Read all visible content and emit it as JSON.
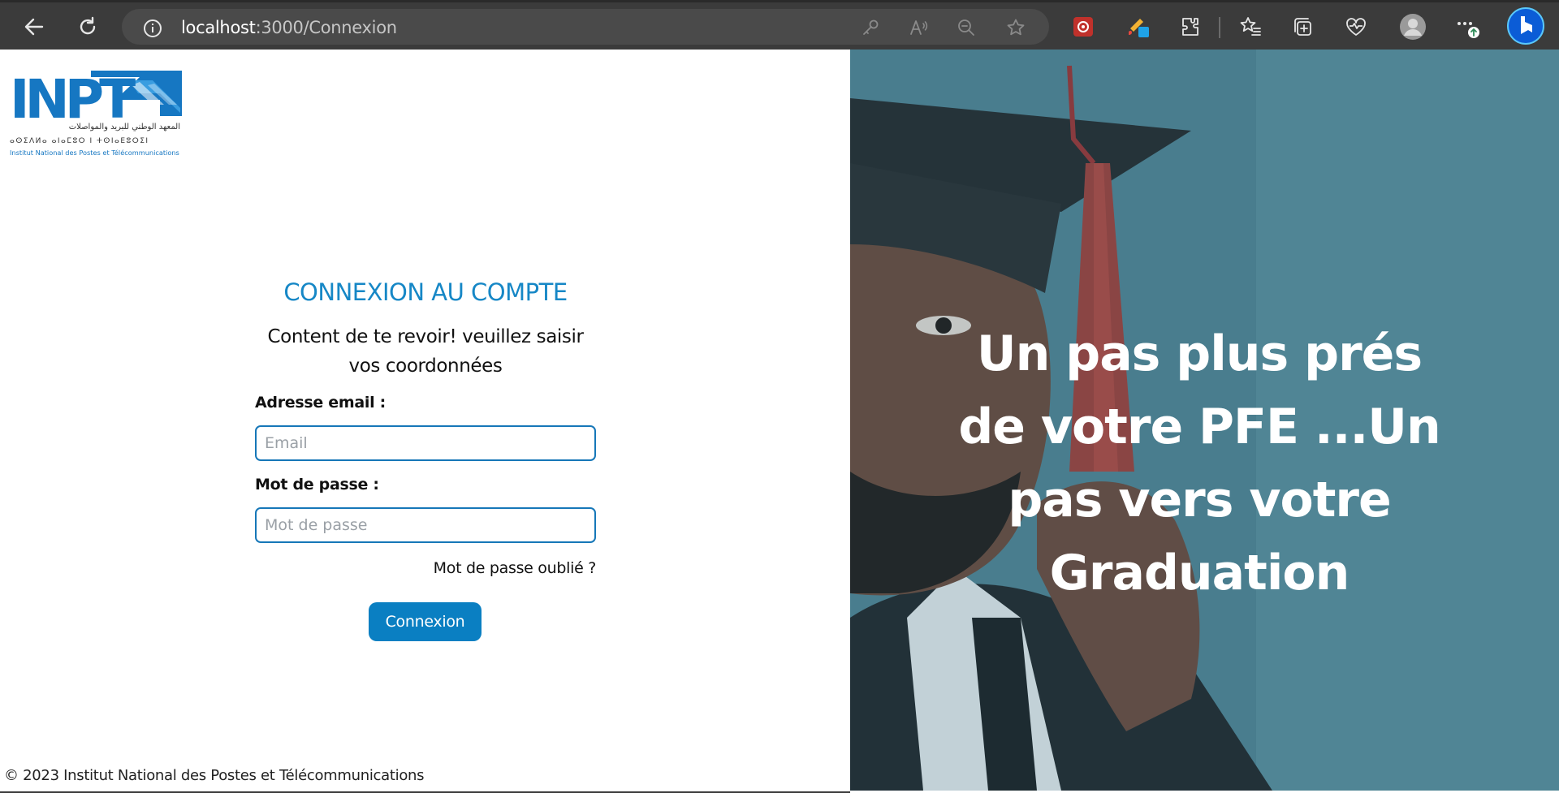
{
  "browser": {
    "url_host": "localhost",
    "url_path": ":3000/Connexion",
    "icons": [
      "back-icon",
      "reload-icon",
      "info-icon",
      "key-icon",
      "read-aloud-icon",
      "zoom-out-icon",
      "favorite-star-icon",
      "extension-red-icon",
      "extension-paint-icon",
      "extensions-icon",
      "favorites-icon",
      "collections-icon",
      "browser-essentials-icon",
      "profile-icon",
      "more-icon",
      "bing-copilot-icon"
    ]
  },
  "logo": {
    "text": "INPT",
    "arabic": "المعهد الوطني للبريد والمواصلات",
    "tifinagh": "ⴰⵙⵉⴷⵍⴰ ⴰⵏⴰⵎⵓⵔ ⵏ ⵜⵙⵏⴰⴹⵓⵔⵉⵏ",
    "full_name": "Institut National des Postes et Télécommunications"
  },
  "form": {
    "title": "CONNEXION AU COMPTE",
    "subtitle": "Content de te revoir! veuillez saisir vos coordonnées",
    "email_label": "Adresse email :",
    "email_placeholder": "Email",
    "password_label": "Mot de passe :",
    "password_placeholder": "Mot de passe",
    "forgot": "Mot de passe oublié ?",
    "submit": "Connexion"
  },
  "footer": {
    "text": "© 2023 Institut National des Postes et Télécommunications"
  },
  "hero": {
    "text": "Un pas plus prés de votre PFE ...Un pas vers votre Graduation"
  },
  "colors": {
    "accent": "#1687c6",
    "button": "#0a7fc2",
    "input_border": "#1677b8",
    "chrome": "#3b3b3b"
  }
}
